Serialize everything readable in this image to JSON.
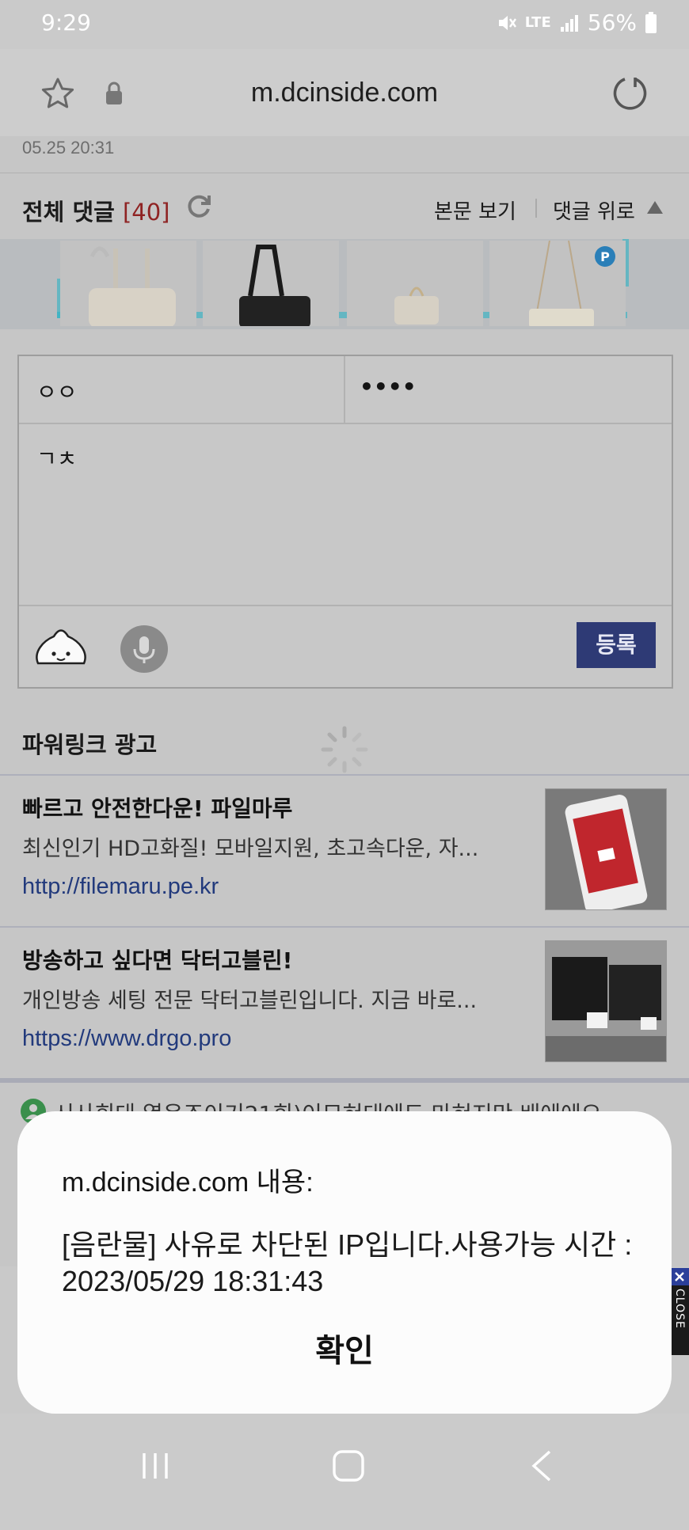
{
  "status_bar": {
    "time": "9:29",
    "network": "LTE",
    "battery": "56%"
  },
  "browser": {
    "url": "m.dcinside.com",
    "icons": [
      "star-icon",
      "lock-icon",
      "reload-icon"
    ]
  },
  "post": {
    "date": "05.25 20:31"
  },
  "comments_header": {
    "title": "전체 댓글",
    "count": "[40]",
    "view_body": "본문 보기",
    "to_top": "댓글 위로"
  },
  "comment_form": {
    "name_value": "ㅇㅇ",
    "password_value": "••••",
    "body_value": "ㄱㅊ",
    "submit_label": "등록"
  },
  "powerlink": {
    "heading": "파워링크 광고",
    "ads": [
      {
        "title": "빠르고 안전한다운! 파일마루",
        "desc": "최신인기 HD고화질! 모바일지원, 초고속다운, 자...",
        "url": "http://filemaru.pe.kr"
      },
      {
        "title": "방송하고 싶다면 닥터고블린!",
        "desc": "개인방송 세팅 전문 닥터고블린입니다. 지금 바로...",
        "url": "https://www.drgo.pro"
      }
    ],
    "partial_text": "시사회대 열은조이기21회)이므혀대에도 마혀지만 배에에오"
  },
  "overlay": {
    "close_label": "CLOSE"
  },
  "dialog": {
    "title": "m.dcinside.com 내용:",
    "message": "[음란물] 사유로 차단된 IP입니다.사용가능 시간 : 2023/05/29 18:31:43",
    "ok_label": "확인"
  },
  "colors": {
    "submit_bg": "#2e3a75",
    "count_red": "#8f2323",
    "link_blue": "#223a7c",
    "ad_border_teal": "#2bb3c4"
  }
}
